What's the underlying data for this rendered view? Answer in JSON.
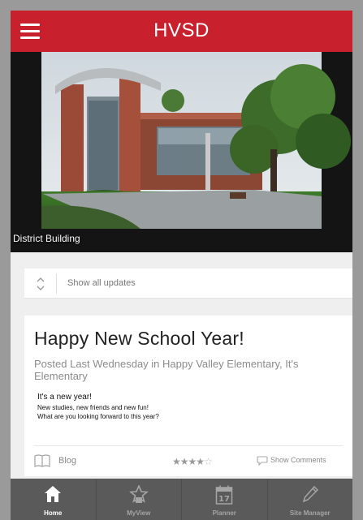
{
  "app": {
    "title": "HVSD"
  },
  "hero": {
    "caption": "District Building"
  },
  "updates": {
    "label": "Show all updates"
  },
  "post": {
    "title": "Happy New School Year!",
    "meta": "Posted Last Wednesday in Happy Valley Elementary, It's Elementary",
    "body": [
      "It's a new year!",
      "New studies, new friends and new fun!",
      "What are you looking forward to this year?"
    ],
    "category": "Blog",
    "rating": 4.5,
    "comments_label": "Show Comments"
  },
  "tabs": [
    {
      "label": "Home",
      "icon": "home-icon",
      "active": true
    },
    {
      "label": "MyView",
      "icon": "star-badge-icon",
      "active": false
    },
    {
      "label": "Planner",
      "icon": "calendar-icon",
      "active": false,
      "calendar_day": "17"
    },
    {
      "label": "Site Manager",
      "icon": "pencil-icon",
      "active": false
    }
  ],
  "colors": {
    "header": "#c8202c",
    "tabbar": "#5a5a5a",
    "background": "#efefef"
  }
}
